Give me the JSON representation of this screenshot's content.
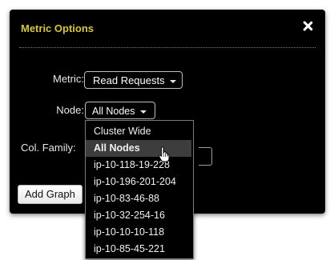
{
  "dialog": {
    "title": "Metric Options"
  },
  "form": {
    "metric_label": "Metric:",
    "metric_value": "Read Requests",
    "node_label": "Node:",
    "node_value": "All Nodes",
    "colfamily_label": "Col. Family:",
    "add_graph_label": "Add Graph"
  },
  "node_dropdown": {
    "items": [
      "Cluster Wide",
      "All Nodes",
      "ip-10-118-19-228",
      "ip-10-196-201-204",
      "ip-10-83-46-88",
      "ip-10-32-254-16",
      "ip-10-10-10-118",
      "ip-10-85-45-221"
    ],
    "selected": "All Nodes"
  },
  "icons": {
    "close": "close-icon",
    "caret": "chevron-down-icon",
    "cursor": "hand-pointer-icon"
  },
  "colors": {
    "title": "#d6c54a",
    "dialog_bg": "#000000",
    "highlight": "#3d3d3d"
  }
}
